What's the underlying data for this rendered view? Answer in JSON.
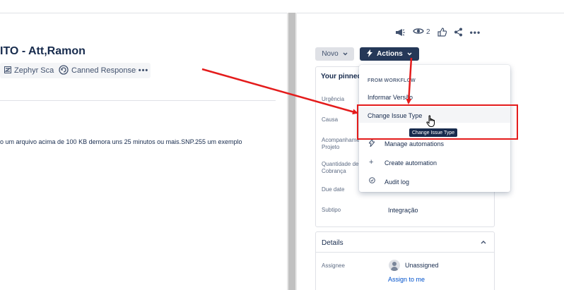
{
  "issue": {
    "title_fragment": "ITO - Att,Ramon",
    "description_fragment": "o um arquivo acima de 100 KB demora uns 25 minutos ou mais.SNP.255 um exemplo"
  },
  "apps": [
    {
      "label": "Zephyr Scale",
      "icon": "zephyr-icon"
    },
    {
      "label": "Canned Responses",
      "icon": "canned-responses-icon"
    }
  ],
  "toolbar": {
    "watchers_count": "2",
    "icons": [
      "megaphone-icon",
      "eye-icon",
      "thumbs-up-icon",
      "share-icon",
      "more-icon"
    ]
  },
  "status_button": {
    "label": "Novo"
  },
  "actions_button": {
    "label": "Actions"
  },
  "pinned": {
    "title_fragment": "Your pinned",
    "fields": [
      {
        "label": "Urgência",
        "value": ""
      },
      {
        "label": "Causa",
        "value": ""
      },
      {
        "label": "Acompanhamento Projeto",
        "label_l1": "Acompanhame",
        "label_l2": "Projeto",
        "value": ""
      },
      {
        "label": "Quantidade de Cobrança",
        "label_l1": "Quantidade de",
        "label_l2": "Cobrança",
        "value": ""
      },
      {
        "label": "Due date",
        "value": ""
      },
      {
        "label": "Subtipo",
        "value": "Integração"
      }
    ]
  },
  "details": {
    "title": "Details",
    "assignee_label": "Assignee",
    "assignee_value": "Unassigned",
    "assign_to_me": "Assign to me"
  },
  "actions_menu": {
    "section": "FROM WORKFLOW",
    "items": [
      {
        "label": "Informar Versão",
        "icon": ""
      },
      {
        "label": "Change Issue Type",
        "icon": ""
      },
      {
        "label": "Manage automations",
        "icon": "lightning-icon"
      },
      {
        "label": "Create automation",
        "icon": "plus-icon"
      },
      {
        "label": "Audit log",
        "icon": "audit-icon"
      }
    ],
    "tooltip": "Change Issue Type"
  },
  "colors": {
    "actions_bg": "#253858",
    "annotation_red": "#e41c1c",
    "link_blue": "#0052cc"
  }
}
